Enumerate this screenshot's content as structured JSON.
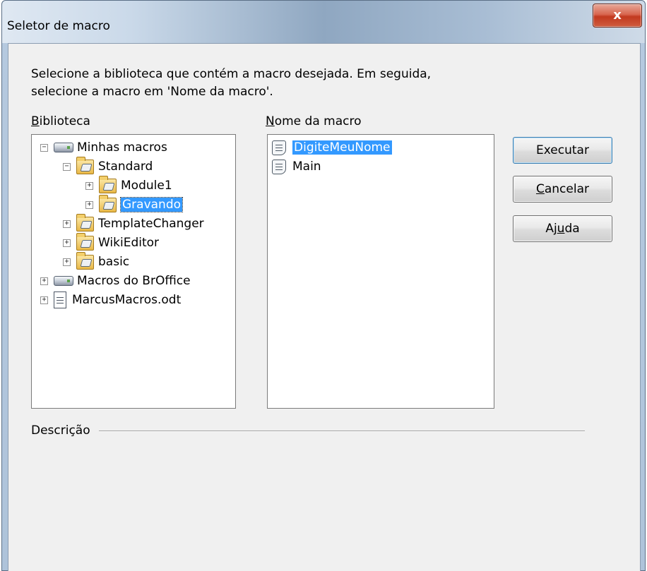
{
  "window": {
    "title": "Seletor de macro",
    "close_glyph": "x"
  },
  "instruction": {
    "line1": "Selecione a biblioteca que contém a macro desejada. Em seguida,",
    "line2": "selecione a macro em 'Nome da macro'."
  },
  "library": {
    "label_accel": "B",
    "label_rest": "iblioteca",
    "tree": [
      {
        "label": "Minhas macros",
        "level": 0,
        "expander": "−",
        "icon": "drive-icon"
      },
      {
        "label": "Standard",
        "level": 1,
        "expander": "−",
        "icon": "folder-icon"
      },
      {
        "label": "Module1",
        "level": 2,
        "expander": "+",
        "icon": "folder-icon"
      },
      {
        "label": "Gravando",
        "level": 2,
        "expander": "+",
        "icon": "folder-icon",
        "selected": true
      },
      {
        "label": "TemplateChanger",
        "level": 1,
        "expander": "+",
        "icon": "folder-icon"
      },
      {
        "label": "WikiEditor",
        "level": 1,
        "expander": "+",
        "icon": "folder-icon"
      },
      {
        "label": "basic",
        "level": 1,
        "expander": "+",
        "icon": "folder-icon"
      },
      {
        "label": "Macros do BrOffice",
        "level": 0,
        "expander": "+",
        "icon": "drive-icon"
      },
      {
        "label": "MarcusMacros.odt",
        "level": 0,
        "expander": "+",
        "icon": "document-icon"
      }
    ]
  },
  "macros": {
    "label_accel": "N",
    "label_rest": "ome da macro",
    "items": [
      {
        "label": "DigiteMeuNome",
        "selected": true
      },
      {
        "label": "Main",
        "selected": false
      }
    ]
  },
  "buttons": {
    "run": "Executar",
    "cancel_accel": "C",
    "cancel_rest": "ancelar",
    "help_pre": "Aj",
    "help_accel": "u",
    "help_post": "da"
  },
  "description": {
    "label": "Descrição"
  },
  "colors": {
    "selection": "#3399ff",
    "dialog_bg": "#f0f0f0",
    "close_button": "#c2391f"
  }
}
